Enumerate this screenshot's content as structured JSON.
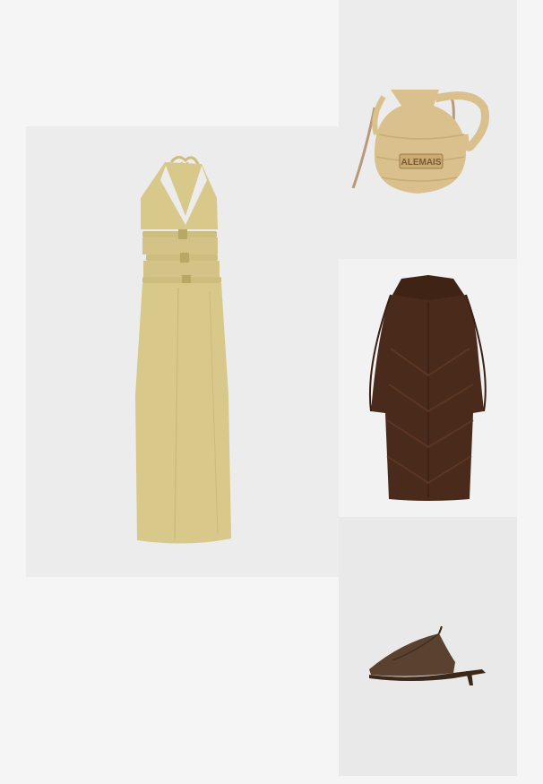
{
  "products": [
    {
      "id": "dress",
      "kind": "product-image",
      "color": "#d8c98b"
    },
    {
      "id": "bag",
      "kind": "product-image",
      "color": "#d9c08c",
      "brand_label": "ALEMAIS"
    },
    {
      "id": "coat",
      "kind": "product-image",
      "color": "#4a2a1a"
    },
    {
      "id": "shoe",
      "kind": "product-image",
      "color": "#5a4130"
    }
  ]
}
